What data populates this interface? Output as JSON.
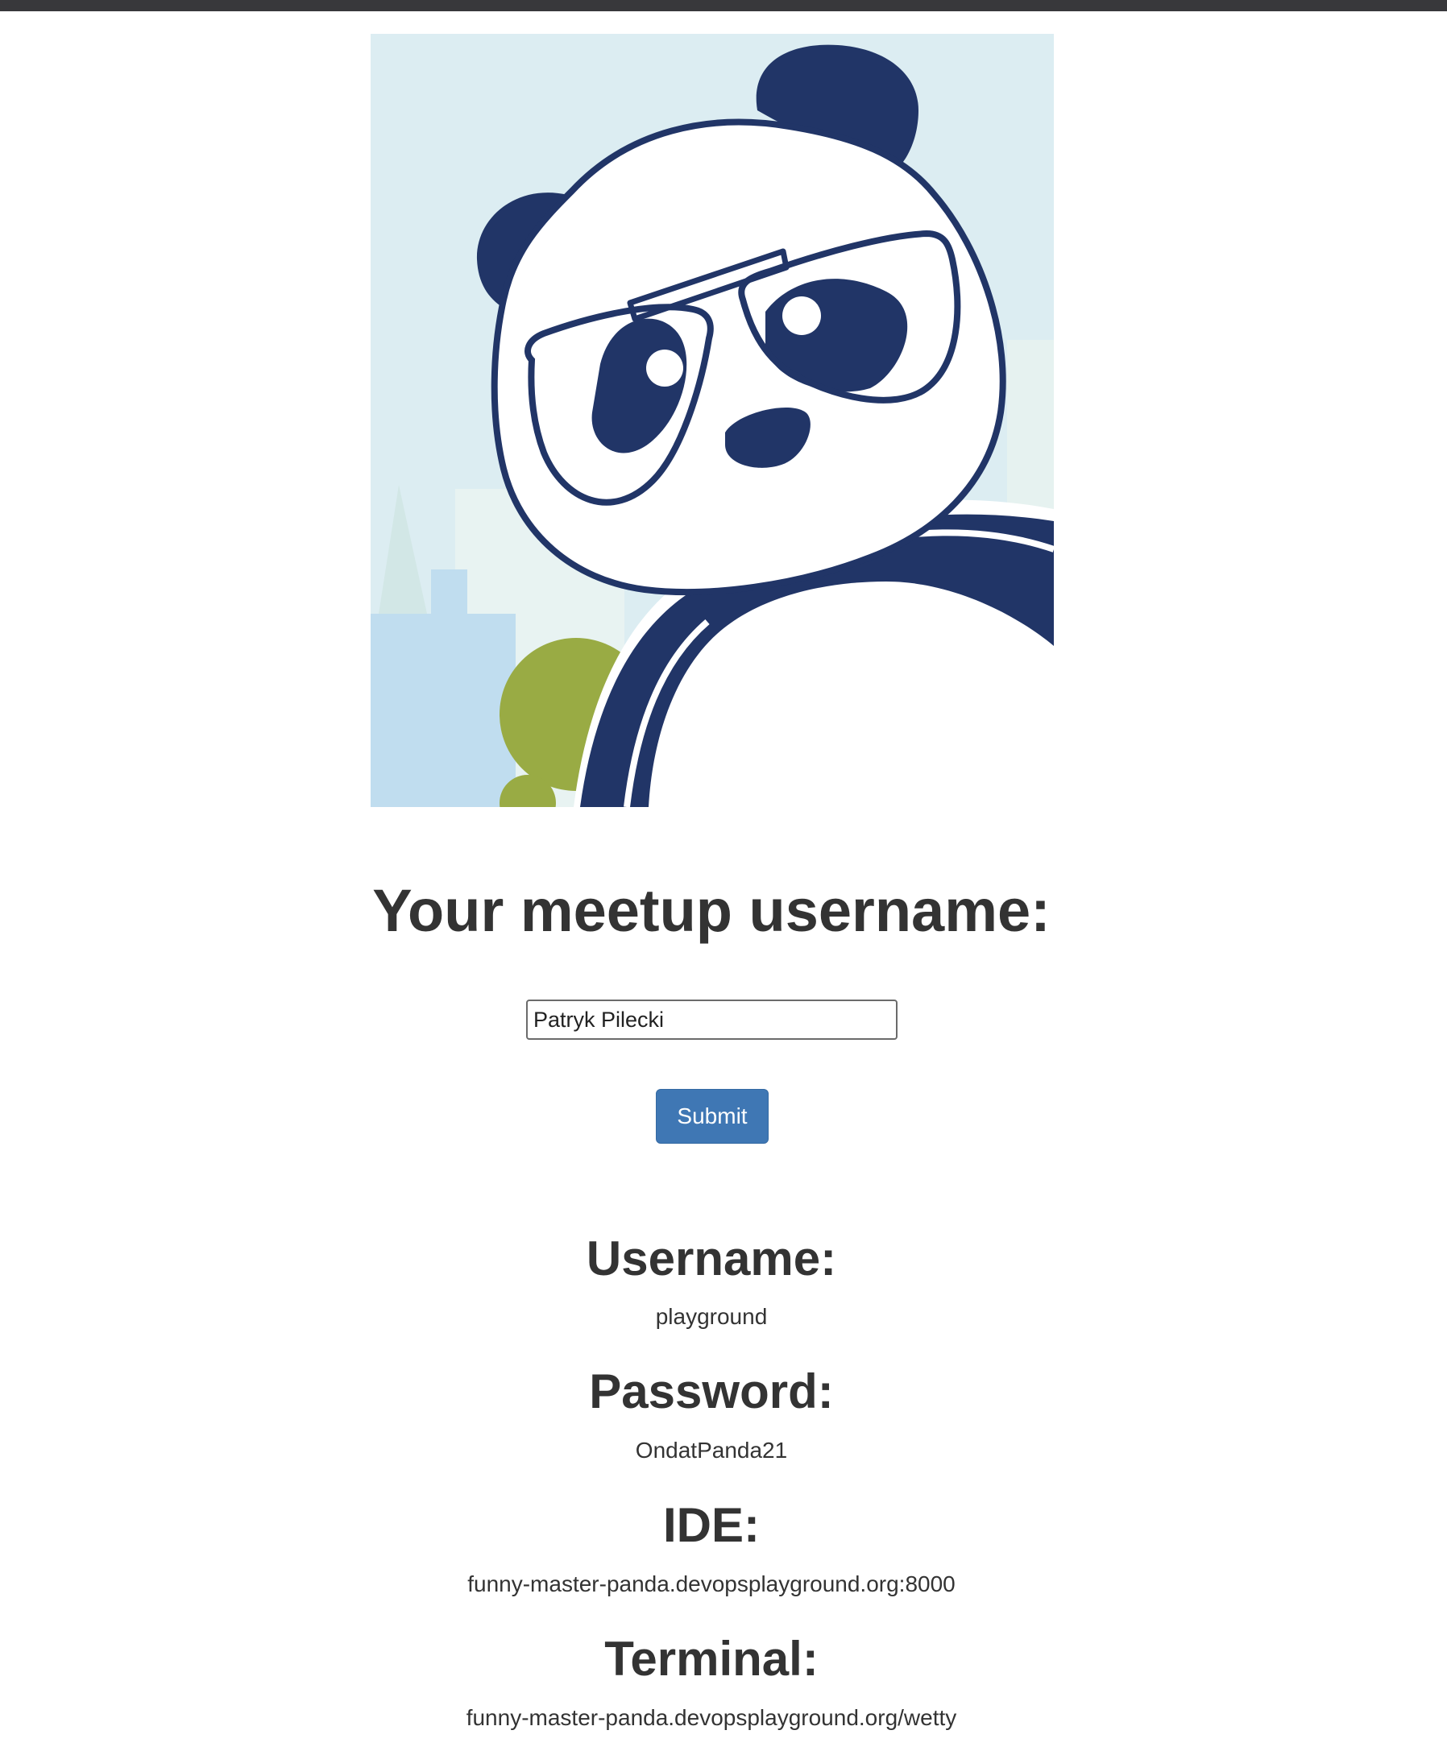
{
  "form": {
    "heading": "Your meetup username:",
    "username_value": "Patryk Pilecki",
    "submit_label": "Submit"
  },
  "credentials": [
    {
      "label": "Username:",
      "value": "playground"
    },
    {
      "label": "Password:",
      "value": "OndatPanda21"
    },
    {
      "label": "IDE:",
      "value": "funny-master-panda.devopsplayground.org:8000"
    },
    {
      "label": "Terminal:",
      "value": "funny-master-panda.devopsplayground.org/wetty"
    }
  ],
  "colors": {
    "panda_navy": "#213567",
    "sky": "#dcedf2",
    "button": "#3f77b4",
    "tree": "#99ab44"
  }
}
